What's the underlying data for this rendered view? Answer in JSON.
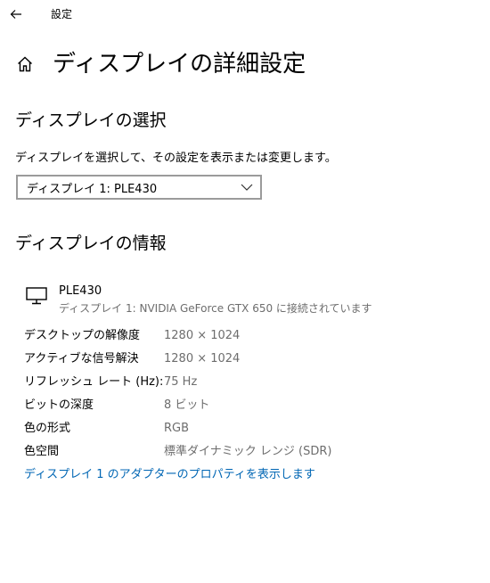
{
  "window": {
    "title": "設定",
    "back_icon": "arrow-left-icon"
  },
  "header": {
    "home_icon": "home-icon",
    "title": "ディスプレイの詳細設定"
  },
  "select_section": {
    "heading": "ディスプレイの選択",
    "description": "ディスプレイを選択して、その設定を表示または変更します。",
    "dropdown": {
      "selected": "ディスプレイ 1: PLE430",
      "icon": "chevron-down-icon"
    }
  },
  "info_section": {
    "heading": "ディスプレイの情報",
    "monitor": {
      "icon": "monitor-icon",
      "name": "PLE430",
      "connection": "ディスプレイ 1: NVIDIA GeForce GTX 650 に接続されています"
    },
    "rows": [
      {
        "label": "デスクトップの解像度",
        "value": "1280 × 1024"
      },
      {
        "label": "アクティブな信号解決",
        "value": "1280 × 1024"
      },
      {
        "label": "リフレッシュ レート (Hz):",
        "value": "75 Hz"
      },
      {
        "label": "ビットの深度",
        "value": "8 ビット"
      },
      {
        "label": "色の形式",
        "value": "RGB"
      },
      {
        "label": "色空間",
        "value": "標準ダイナミック レンジ (SDR)"
      }
    ],
    "adapter_link": "ディスプレイ 1 のアダプターのプロパティを表示します"
  },
  "colors": {
    "link": "#0066b4",
    "secondary_text": "#6d6d6d",
    "border": "#9b9b9b"
  }
}
